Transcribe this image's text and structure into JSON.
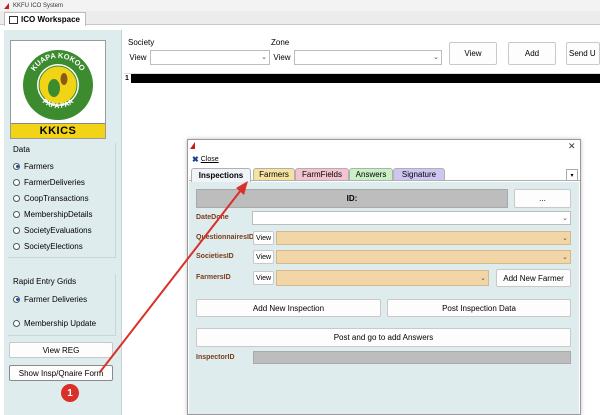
{
  "app": {
    "title": "KKFU ICO System",
    "tab_title": "ICO Workspace"
  },
  "logo": {
    "ring_top": "KUAPA KOKOO",
    "ring_bottom": "PAPA PAA",
    "banner": "KKICS"
  },
  "data_group": {
    "title": "Data",
    "options": [
      "Farmers",
      "FarmerDeliveries",
      "CoopTransactions",
      "MembershipDetails",
      "SocietyEvaluations",
      "SocietyElections"
    ],
    "selected": "Farmers"
  },
  "rapid_group": {
    "title": "Rapid Entry Grids",
    "options": [
      "Farmer Deliveries",
      "Membership Update"
    ],
    "selected": "Farmer Deliveries"
  },
  "sidebar_buttons": {
    "view_reg": "View REG",
    "show_form": "Show Insp/Qnaire Form"
  },
  "toolbar": {
    "society_label": "Society",
    "zone_label": "Zone",
    "view_small": "View",
    "view_button": "View",
    "add_button": "Add",
    "send_button": "Send U"
  },
  "grid": {
    "row_number": "1"
  },
  "dialog": {
    "close_label": "Close",
    "tabs": [
      "Inspections",
      "Farmers",
      "FarmFields",
      "Answers",
      "Signature"
    ],
    "active_tab": "Inspections",
    "id_label": "ID:",
    "ellipsis": "...",
    "fields": {
      "datedone": "DateDone",
      "questionnaires": "QuestionnairesID",
      "societies": "SocietiesID",
      "farmers": "FarmersID",
      "inspector": "InspectorID"
    },
    "view_label": "View",
    "buttons": {
      "add_farmer": "Add New Farmer",
      "add_inspection": "Add New Inspection",
      "post_inspection": "Post Inspection Data",
      "post_answers": "Post and go to add Answers"
    }
  },
  "annotation": {
    "step": "1"
  },
  "colors": {
    "accent_red": "#d9302a",
    "panel_bg": "#dfecee",
    "logo_green": "#3c8b2f",
    "banner_yellow": "#f2d417",
    "field_tan": "#f3d6a8"
  }
}
